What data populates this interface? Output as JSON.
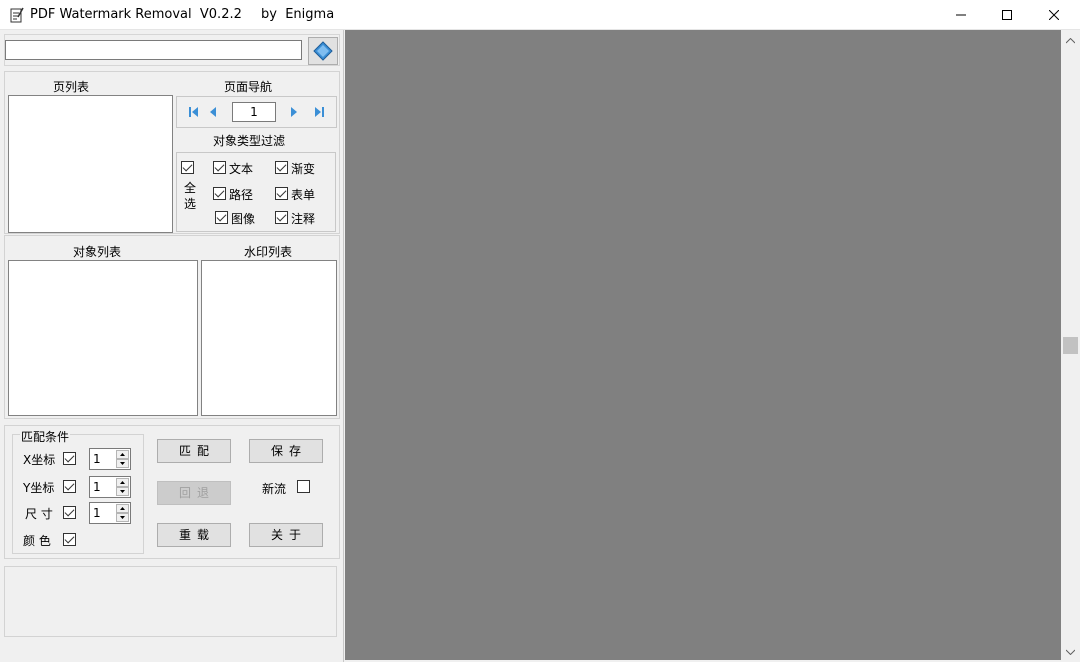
{
  "titlebar": {
    "title": "PDF Watermark Removal  V0.2.2",
    "author": "by  Enigma",
    "icons": [
      "app-icon",
      "minimize-icon",
      "maximize-icon",
      "close-icon"
    ]
  },
  "path": {
    "value": ""
  },
  "page_list": {
    "label": "页列表"
  },
  "page_nav": {
    "label": "页面导航",
    "page": "1"
  },
  "type_filter": {
    "label": "对象类型过滤",
    "select_all": "全\n选",
    "items": [
      {
        "label": "文本",
        "checked": true
      },
      {
        "label": "渐变",
        "checked": true
      },
      {
        "label": "路径",
        "checked": true
      },
      {
        "label": "表单",
        "checked": true
      },
      {
        "label": "图像",
        "checked": true
      },
      {
        "label": "注释",
        "checked": true
      }
    ]
  },
  "object_list": {
    "label": "对象列表"
  },
  "watermark_list": {
    "label": "水印列表"
  },
  "match": {
    "label": "匹配条件",
    "x": {
      "label": "X坐标",
      "value": "1",
      "checked": true
    },
    "y": {
      "label": "Y坐标",
      "value": "1",
      "checked": true
    },
    "size": {
      "label": "尺 寸",
      "value": "1",
      "checked": true
    },
    "color": {
      "label": "颜 色",
      "checked": true
    }
  },
  "buttons": {
    "match": "匹配",
    "save": "保存",
    "undo": "回退",
    "reload": "重载",
    "about": "关于",
    "new_stream": "新流"
  },
  "colors": {
    "preview_bg": "#808080",
    "panel_bg": "#f0f0f0",
    "open_icon": "#3b8fd6"
  }
}
